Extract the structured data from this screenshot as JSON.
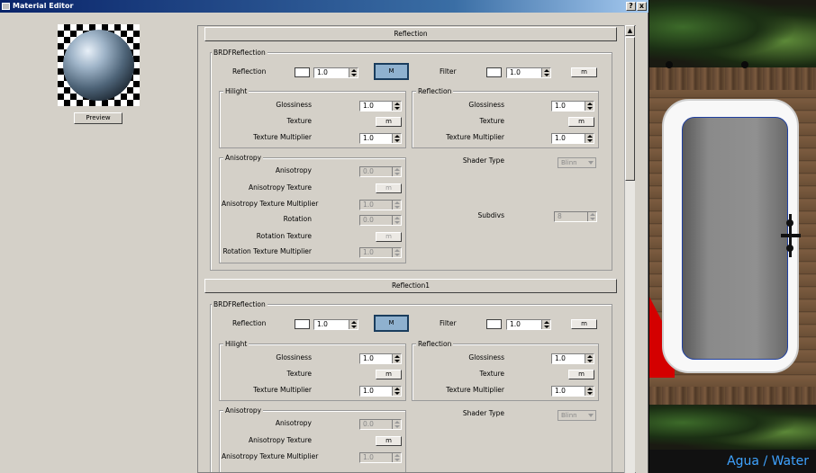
{
  "window": {
    "title": "Material Editor",
    "help_label": "?",
    "close_label": "x"
  },
  "preview": {
    "button_label": "Preview"
  },
  "rollouts": [
    {
      "title": "Reflection",
      "brdf_group": "BRDFReflection",
      "reflection_label": "Reflection",
      "reflection_value": "1.0",
      "reflection_map": "M",
      "filter_label": "Filter",
      "filter_value": "1.0",
      "filter_map": "m",
      "hilight": {
        "title": "Hilight",
        "glossiness_label": "Glossiness",
        "glossiness_value": "1.0",
        "texture_label": "Texture",
        "texture_map": "m",
        "multiplier_label": "Texture Multiplier",
        "multiplier_value": "1.0"
      },
      "reflection_group": {
        "title": "Reflection",
        "glossiness_label": "Glossiness",
        "glossiness_value": "1.0",
        "texture_label": "Texture",
        "texture_map": "m",
        "multiplier_label": "Texture Multiplier",
        "multiplier_value": "1.0"
      },
      "anisotropy": {
        "title": "Anisotropy",
        "anisotropy_label": "Anisotropy",
        "anisotropy_value": "0.0",
        "aniso_texture_label": "Anisotropy Texture",
        "aniso_texture_map": "m",
        "aniso_multiplier_label": "Anisotropy Texture Multiplier",
        "aniso_multiplier_value": "1.0",
        "rotation_label": "Rotation",
        "rotation_value": "0.0",
        "rotation_texture_label": "Rotation Texture",
        "rotation_texture_map": "m",
        "rotation_multiplier_label": "Rotation Texture Multiplier",
        "rotation_multiplier_value": "1.0"
      },
      "shader_type_label": "Shader Type",
      "shader_type_value": "Blinn",
      "subdivs_label": "Subdivs",
      "subdivs_value": "8"
    },
    {
      "title": "Reflection1",
      "brdf_group": "BRDFReflection",
      "reflection_label": "Reflection",
      "reflection_value": "1.0",
      "reflection_map": "M",
      "filter_label": "Filter",
      "filter_value": "1.0",
      "filter_map": "m",
      "hilight": {
        "title": "Hilight",
        "glossiness_label": "Glossiness",
        "glossiness_value": "1.0",
        "texture_label": "Texture",
        "texture_map": "m",
        "multiplier_label": "Texture Multiplier",
        "multiplier_value": "1.0"
      },
      "reflection_group": {
        "title": "Reflection",
        "glossiness_label": "Glossiness",
        "glossiness_value": "1.0",
        "texture_label": "Texture",
        "texture_map": "m",
        "multiplier_label": "Texture Multiplier",
        "multiplier_value": "1.0"
      },
      "anisotropy": {
        "title": "Anisotropy",
        "anisotropy_label": "Anisotropy",
        "anisotropy_value": "0.0",
        "aniso_texture_label": "Anisotropy Texture",
        "aniso_texture_map": "m",
        "aniso_multiplier_label": "Anisotropy Texture Multiplier",
        "aniso_multiplier_value": "1.0"
      },
      "shader_type_label": "Shader Type",
      "shader_type_value": "Blinn"
    }
  ],
  "viewport": {
    "caption": "Agua / Water"
  },
  "colors": {
    "panel": "#d4d0c8",
    "titlebar": "#0a246a",
    "selected_map": "#8fb1cf",
    "caption_text": "#3fa3ff"
  }
}
